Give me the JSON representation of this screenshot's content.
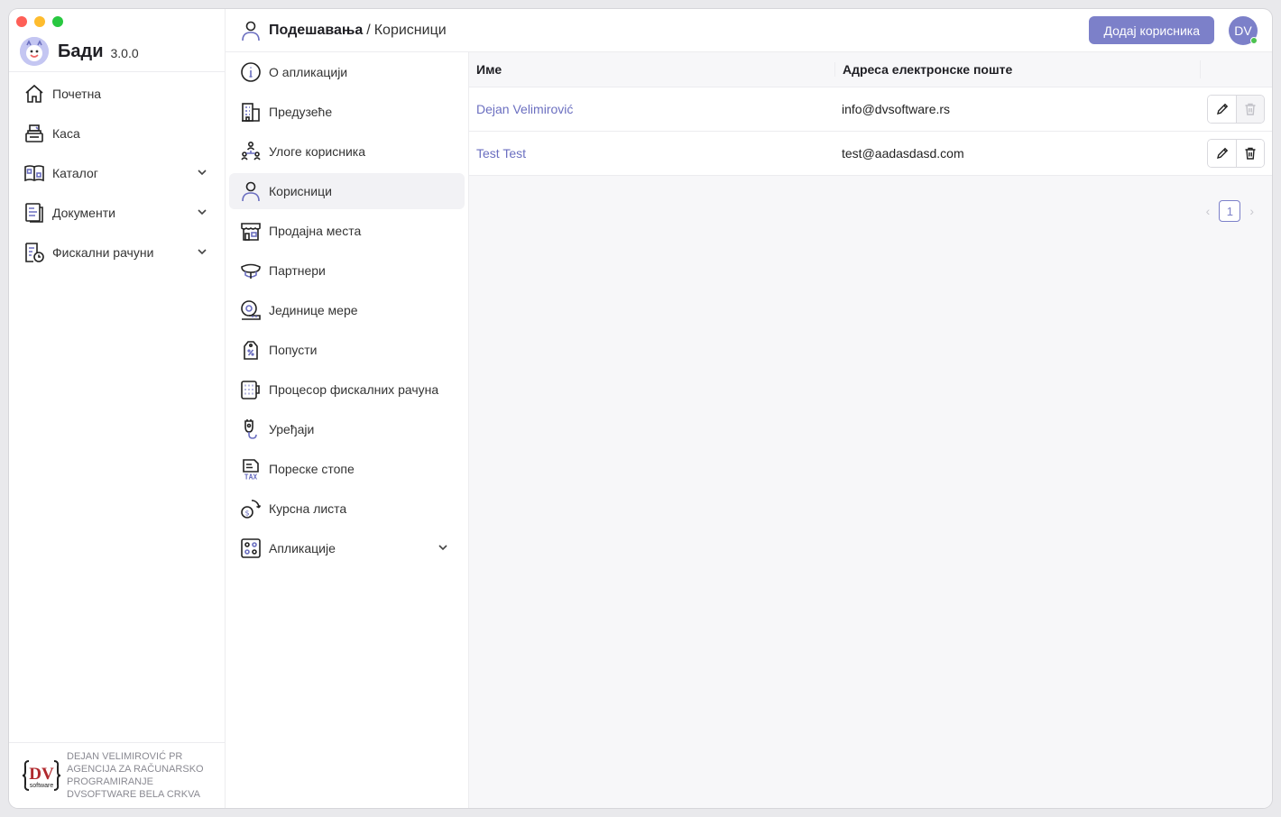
{
  "app": {
    "name": "Бади",
    "version": "3.0.0"
  },
  "window_controls": {
    "close_color": "#fe5f57",
    "minimize_color": "#febc2e",
    "zoom_color": "#28c840"
  },
  "sidebar": {
    "items": [
      {
        "label": "Почетна",
        "icon": "home-icon",
        "expandable": false
      },
      {
        "label": "Каса",
        "icon": "cash-register-icon",
        "expandable": false
      },
      {
        "label": "Каталог",
        "icon": "catalog-icon",
        "expandable": true
      },
      {
        "label": "Документи",
        "icon": "documents-icon",
        "expandable": true
      },
      {
        "label": "Фискални рачуни",
        "icon": "fiscal-receipts-icon",
        "expandable": true
      }
    ],
    "footer": {
      "line1": "DEJAN VELIMIROVIĆ PR",
      "line2": "AGENCIJA ZA RAČUNARSKO",
      "line3": "PROGRAMIRANJE",
      "line4": "DVSOFTWARE BELA CRKVA",
      "logo_text": "DV",
      "logo_sub": "software"
    }
  },
  "header": {
    "breadcrumb_parent": "Подешавања",
    "breadcrumb_separator": "/",
    "breadcrumb_current": "Корисници",
    "add_button_label": "Додај корисника",
    "avatar_initials": "DV",
    "accent_color": "#7c80c9",
    "online_color": "#4cc24f"
  },
  "settings_nav": {
    "items": [
      {
        "label": "О апликацији",
        "icon": "info-icon",
        "active": false
      },
      {
        "label": "Предузеће",
        "icon": "company-icon",
        "active": false
      },
      {
        "label": "Улоге корисника",
        "icon": "user-roles-icon",
        "active": false
      },
      {
        "label": "Корисници",
        "icon": "user-icon",
        "active": true
      },
      {
        "label": "Продајна места",
        "icon": "store-icon",
        "active": false
      },
      {
        "label": "Партнери",
        "icon": "partners-icon",
        "active": false
      },
      {
        "label": "Јединице мере",
        "icon": "measure-units-icon",
        "active": false
      },
      {
        "label": "Попусти",
        "icon": "discount-tag-icon",
        "active": false
      },
      {
        "label": "Процесор фискалних рачуна",
        "icon": "fiscal-processor-icon",
        "active": false
      },
      {
        "label": "Уређаји",
        "icon": "devices-icon",
        "active": false
      },
      {
        "label": "Пореске стопе",
        "icon": "tax-rates-icon",
        "active": false
      },
      {
        "label": "Курсна листа",
        "icon": "exchange-rates-icon",
        "active": false
      },
      {
        "label": "Апликације",
        "icon": "apps-icon",
        "active": false,
        "expandable": true
      }
    ]
  },
  "users_table": {
    "columns": [
      "Име",
      "Адреса електронске поште"
    ],
    "rows": [
      {
        "name": "Dejan Velimirović",
        "email": "info@dvsoftware.rs",
        "delete_enabled": false
      },
      {
        "name": "Test Test",
        "email": "test@aadasdasd.com",
        "delete_enabled": true
      }
    ]
  },
  "pagination": {
    "current_page": "1",
    "prev": "‹",
    "next": "›"
  }
}
